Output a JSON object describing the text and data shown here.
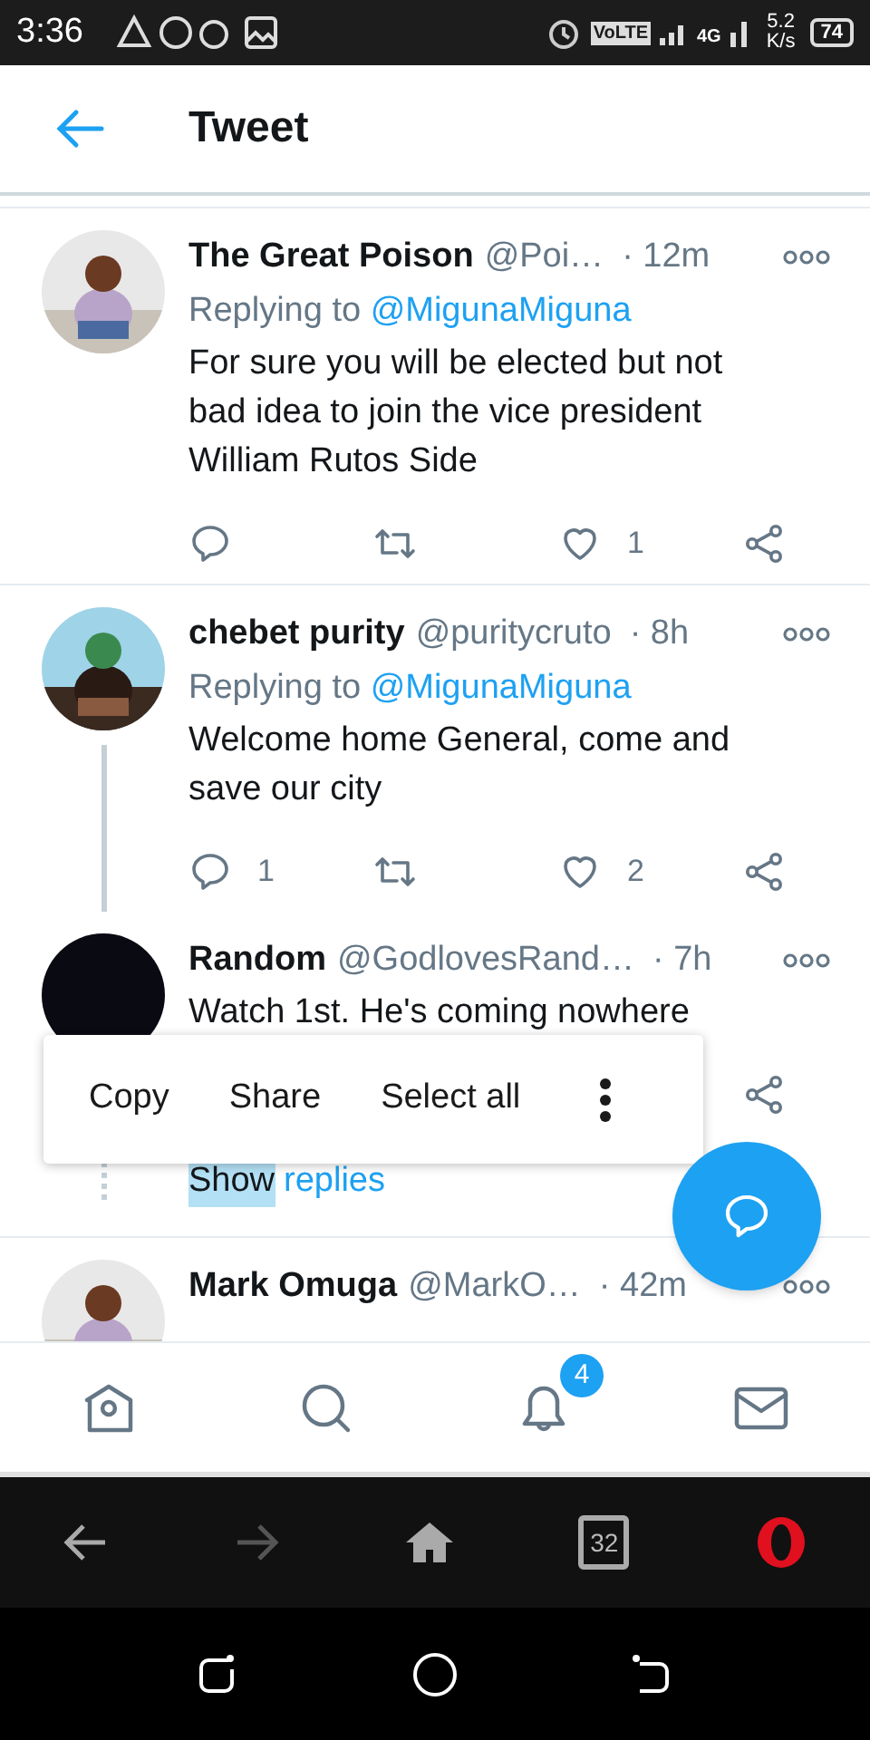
{
  "status_bar": {
    "time": "3:36",
    "volte": "VoLTE",
    "network": "4G",
    "speed_value": "5.2",
    "speed_unit": "K/s",
    "battery": "74"
  },
  "header": {
    "title": "Tweet"
  },
  "tweets": [
    {
      "name": "The Great Poison",
      "handle": "@Poi…",
      "time": "· 12m",
      "replying_prefix": "Replying to",
      "replying_to": "@MigunaMiguna",
      "text": "For sure you will be elected but not bad idea to join the vice president William Rutos Side",
      "thread_line": false,
      "actions": [
        {
          "kind": "reply"
        },
        {
          "kind": "retweet"
        },
        {
          "kind": "like",
          "count": "1"
        },
        {
          "kind": "share"
        }
      ]
    },
    {
      "name": "chebet purity",
      "handle": "@puritycruto",
      "time": "· 8h",
      "replying_prefix": "Replying to",
      "replying_to": "@MigunaMiguna",
      "text": "Welcome home General, come and save our city",
      "thread_line": true,
      "actions": [
        {
          "kind": "reply",
          "count": "1"
        },
        {
          "kind": "retweet"
        },
        {
          "kind": "like",
          "count": "2"
        },
        {
          "kind": "share"
        }
      ]
    },
    {
      "name": "Random",
      "handle": "@GodlovesRand…",
      "time": "· 7h",
      "text": "Watch 1st. He's coming nowhere",
      "thread_line": false,
      "avatar": {
        "kind": "dark"
      },
      "actions": [
        {
          "kind": "share"
        }
      ],
      "show_replies": {
        "selected_part": "Show",
        "link": "replies"
      }
    },
    {
      "name": "Mark Omuga",
      "handle": "@MarkO…",
      "time": "· 42m",
      "thread_line": false
    }
  ],
  "context_menu": {
    "items": [
      "Copy",
      "Share",
      "Select all"
    ]
  },
  "bottom_nav": {
    "items": [
      {
        "kind": "home"
      },
      {
        "kind": "search"
      },
      {
        "kind": "notifications",
        "badge": "4"
      },
      {
        "kind": "messages"
      }
    ]
  },
  "browser_bar": {
    "tabs_count": "32"
  }
}
